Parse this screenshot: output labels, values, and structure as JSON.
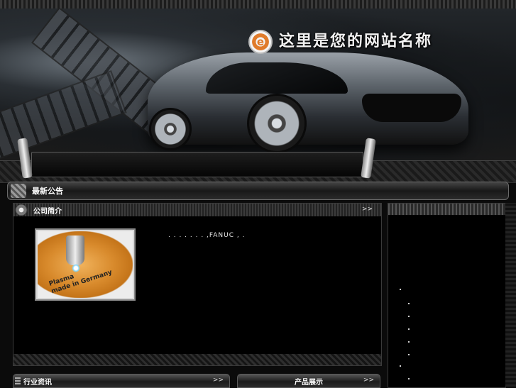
{
  "header": {
    "site_name": "这里是您的网站名称",
    "logo_glyph": "e"
  },
  "notice": {
    "title": "最新公告"
  },
  "company_intro": {
    "title": "公司简介",
    "more": ">>",
    "text": ".   .   .   .   .   .   .   ,FANUC  ,    .",
    "image": {
      "caption_line1": "Plasma",
      "caption_line2": "made in Germany"
    }
  },
  "bottom_tabs": {
    "news": {
      "label": "行业资讯",
      "more": ">>"
    },
    "products": {
      "label": "产品展示",
      "more": ">>"
    }
  },
  "colors": {
    "background": "#0b0b0b",
    "accent_orange": "#e07b2a",
    "text": "#e6e6e6"
  }
}
